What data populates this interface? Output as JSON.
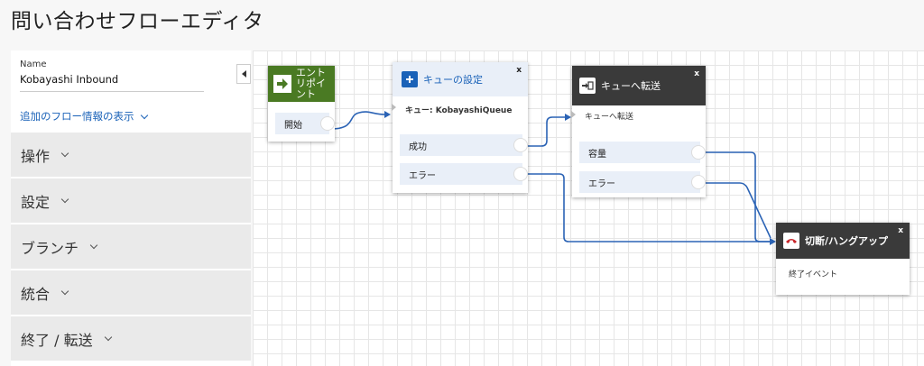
{
  "page_title": "問い合わせフローエディタ",
  "sidebar": {
    "name_label": "Name",
    "name_value": "Kobayashi Inbound",
    "more_info": "追加のフロー情報の表示",
    "sections": [
      "操作",
      "設定",
      "ブランチ",
      "統合",
      "終了 / 転送"
    ]
  },
  "blocks": {
    "entry": {
      "title": "エントリポイント",
      "port_start": "開始",
      "color": "#4a7a23"
    },
    "set_queue": {
      "title": "キューの設定",
      "detail": "キュー: KobayashiQueue",
      "port_success": "成功",
      "port_error": "エラー",
      "close": "x",
      "title_color": "#1a62b8"
    },
    "transfer_queue": {
      "title": "キューへ転送",
      "detail": "キューへ転送",
      "port_capacity": "容量",
      "port_error": "エラー",
      "close": "x",
      "header_color": "#3a3a3a"
    },
    "disconnect": {
      "title": "切断/ハングアップ",
      "detail": "終了イベント",
      "close": "x",
      "header_color": "#3a3a3a",
      "icon_color": "#c8272b"
    }
  },
  "colors": {
    "wire": "#2b63b5",
    "link": "#1a62b8"
  }
}
